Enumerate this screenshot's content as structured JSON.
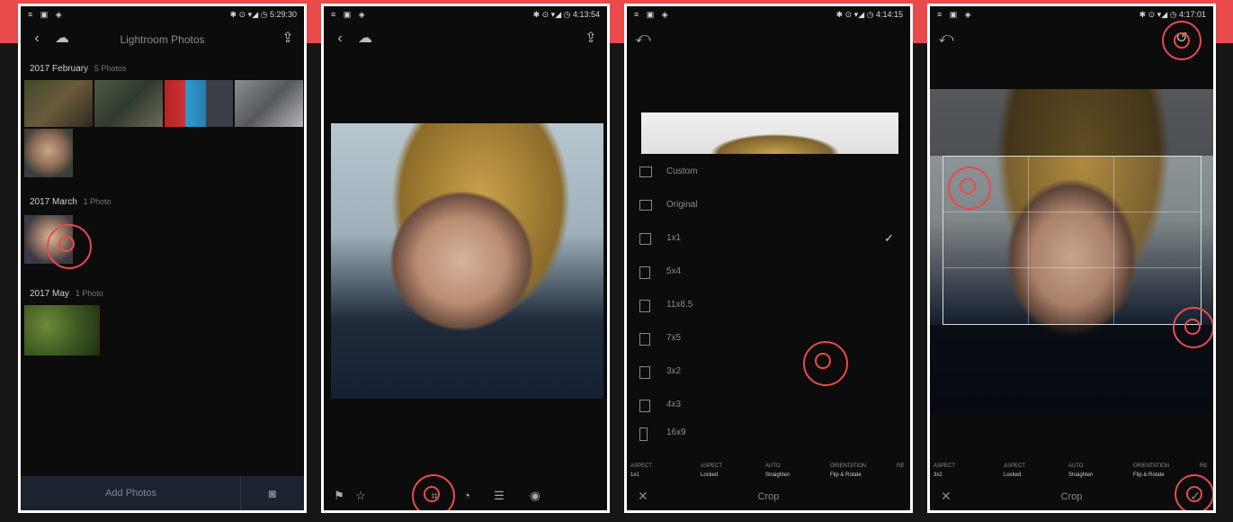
{
  "colors": {
    "accent": "#e94b4b",
    "frame": "#ffffff",
    "screen_bg": "#0c0c0c",
    "nav_bottom": "#1c2330"
  },
  "screens": [
    {
      "status": {
        "icons": "≡ ▣ ◈",
        "right": "✱ ⊙ ▾◢ ◷ 5:29:30"
      },
      "nav": {
        "back_icon": "back-arrow-icon",
        "cloud_icon": "cloud-icon",
        "title": "Lightroom Photos",
        "share_icon": "share-icon"
      },
      "sections": [
        {
          "title": "2017 February",
          "count": "5 Photos"
        },
        {
          "title": "2017 March",
          "count": "1 Photo"
        },
        {
          "title": "2017 May",
          "count": "1 Photo"
        }
      ],
      "bottom": {
        "add_photos": "Add Photos",
        "camera_icon": "camera-icon"
      }
    },
    {
      "status": {
        "icons": "≡ ▣ ◈",
        "right": "✱ ⊙ ▾◢ ◷ 4:13:54"
      },
      "tools": [
        "flag-icon",
        "star-icon",
        "crop-icon",
        "presets-icon",
        "adjust-icon",
        "selective-icon"
      ]
    },
    {
      "status": {
        "icons": "≡ ▣ ◈",
        "right": "✱ ⊙ ▾◢ ◷ 4:14:15"
      },
      "ratios": [
        "Custom",
        "Original",
        "1x1",
        "5x4",
        "11x8.5",
        "7x5",
        "3x2",
        "4x3",
        "16x9"
      ],
      "selected_ratio": "1x1",
      "crop_options": [
        {
          "label": "ASPECT",
          "value": "1x1"
        },
        {
          "label": "ASPECT",
          "value": "Locked"
        },
        {
          "label": "AUTO",
          "value": "Straighten"
        },
        {
          "label": "ORIENTATION",
          "value": "Flip & Rotate"
        },
        {
          "label": "RE",
          "value": ""
        }
      ],
      "crop_title": "Crop",
      "close_icon": "close-icon"
    },
    {
      "status": {
        "icons": "≡ ▣ ◈",
        "right": "✱ ⊙ ▾◢ ◷ 4:17:01"
      },
      "crop_options": [
        {
          "label": "ASPECT",
          "value": "3x2"
        },
        {
          "label": "ASPECT",
          "value": "Locked"
        },
        {
          "label": "AUTO",
          "value": "Straighten"
        },
        {
          "label": "ORIENTATION",
          "value": "Flip & Rotate"
        },
        {
          "label": "RE",
          "value": ""
        }
      ],
      "crop_title": "Crop",
      "close_icon": "close-icon",
      "undo_icon": "undo-icon",
      "confirm_icon": "confirm-icon"
    }
  ]
}
